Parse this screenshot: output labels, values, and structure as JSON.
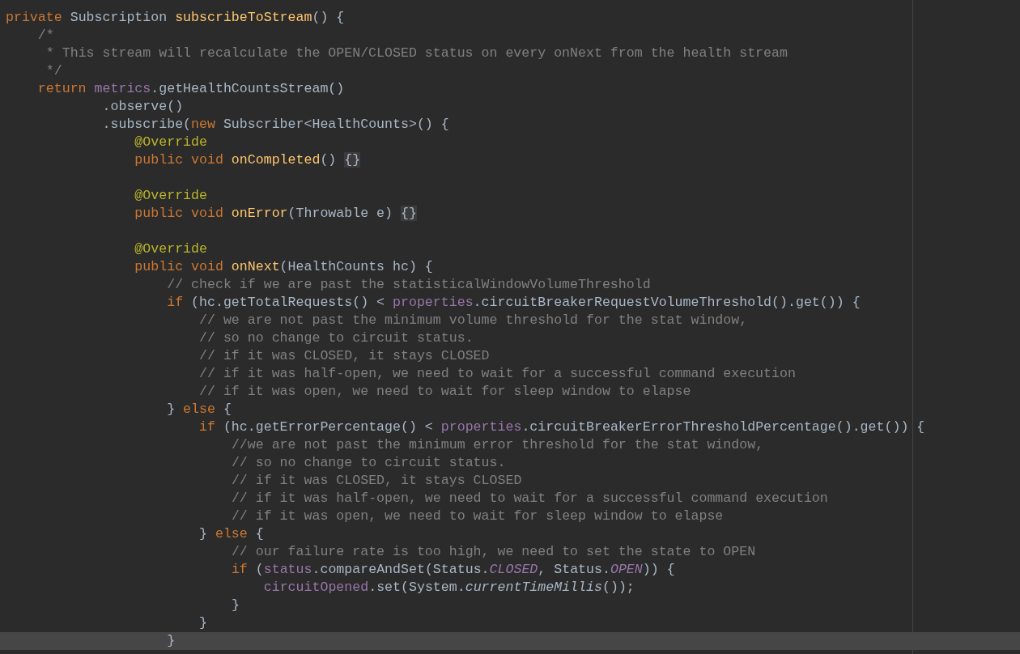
{
  "editor": {
    "lines": [
      {
        "current": false,
        "tokens": [
          {
            "kind": "keyword",
            "text": "private"
          },
          {
            "kind": "plain",
            "text": " Subscription "
          },
          {
            "kind": "decl",
            "text": "subscribeToStream"
          },
          {
            "kind": "plain",
            "text": "() {"
          }
        ]
      },
      {
        "current": false,
        "tokens": [
          {
            "kind": "comment",
            "text": "    /*"
          }
        ]
      },
      {
        "current": false,
        "tokens": [
          {
            "kind": "comment",
            "text": "     * This stream will recalculate the OPEN/CLOSED status on every onNext from the health stream"
          }
        ]
      },
      {
        "current": false,
        "tokens": [
          {
            "kind": "comment",
            "text": "     */"
          }
        ]
      },
      {
        "current": false,
        "tokens": [
          {
            "kind": "keyword",
            "text": "    return "
          },
          {
            "kind": "field",
            "text": "metrics"
          },
          {
            "kind": "plain",
            "text": ".getHealthCountsStream()"
          }
        ]
      },
      {
        "current": false,
        "tokens": [
          {
            "kind": "plain",
            "text": "            .observe()"
          }
        ]
      },
      {
        "current": false,
        "tokens": [
          {
            "kind": "plain",
            "text": "            .subscribe("
          },
          {
            "kind": "keyword",
            "text": "new "
          },
          {
            "kind": "plain",
            "text": "Subscriber<HealthCounts>() {"
          }
        ]
      },
      {
        "current": false,
        "tokens": [
          {
            "kind": "annotation",
            "text": "                @Override"
          }
        ]
      },
      {
        "current": false,
        "tokens": [
          {
            "kind": "keyword",
            "text": "                public void "
          },
          {
            "kind": "decl",
            "text": "onCompleted"
          },
          {
            "kind": "plain",
            "text": "() "
          },
          {
            "kind": "match",
            "text": "{}"
          }
        ]
      },
      {
        "current": false
      },
      {
        "current": false,
        "tokens": [
          {
            "kind": "annotation",
            "text": "                @Override"
          }
        ]
      },
      {
        "current": false,
        "tokens": [
          {
            "kind": "keyword",
            "text": "                public void "
          },
          {
            "kind": "decl",
            "text": "onError"
          },
          {
            "kind": "plain",
            "text": "(Throwable e) "
          },
          {
            "kind": "match",
            "text": "{}"
          }
        ]
      },
      {
        "current": false
      },
      {
        "current": false,
        "tokens": [
          {
            "kind": "annotation",
            "text": "                @Override"
          }
        ]
      },
      {
        "current": false,
        "tokens": [
          {
            "kind": "keyword",
            "text": "                public void "
          },
          {
            "kind": "decl",
            "text": "onNext"
          },
          {
            "kind": "plain",
            "text": "(HealthCounts hc) {"
          }
        ]
      },
      {
        "current": false,
        "tokens": [
          {
            "kind": "comment",
            "text": "                    // check if we are past the statisticalWindowVolumeThreshold"
          }
        ]
      },
      {
        "current": false,
        "tokens": [
          {
            "kind": "keyword",
            "text": "                    if "
          },
          {
            "kind": "plain",
            "text": "(hc.getTotalRequests() < "
          },
          {
            "kind": "field",
            "text": "properties"
          },
          {
            "kind": "plain",
            "text": ".circuitBreakerRequestVolumeThreshold().get()) {"
          }
        ]
      },
      {
        "current": false,
        "tokens": [
          {
            "kind": "comment",
            "text": "                        // we are not past the minimum volume threshold for the stat window,"
          }
        ]
      },
      {
        "current": false,
        "tokens": [
          {
            "kind": "comment",
            "text": "                        // so no change to circuit status."
          }
        ]
      },
      {
        "current": false,
        "tokens": [
          {
            "kind": "comment",
            "text": "                        // if it was CLOSED, it stays CLOSED"
          }
        ]
      },
      {
        "current": false,
        "tokens": [
          {
            "kind": "comment",
            "text": "                        // if it was half-open, we need to wait for a successful command execution"
          }
        ]
      },
      {
        "current": false,
        "tokens": [
          {
            "kind": "comment",
            "text": "                        // if it was open, we need to wait for sleep window to elapse"
          }
        ]
      },
      {
        "current": false,
        "tokens": [
          {
            "kind": "plain",
            "text": "                    } "
          },
          {
            "kind": "keyword",
            "text": "else"
          },
          {
            "kind": "plain",
            "text": " {"
          }
        ]
      },
      {
        "current": false,
        "tokens": [
          {
            "kind": "keyword",
            "text": "                        if "
          },
          {
            "kind": "plain",
            "text": "(hc.getErrorPercentage() < "
          },
          {
            "kind": "field",
            "text": "properties"
          },
          {
            "kind": "plain",
            "text": ".circuitBreakerErrorThresholdPercentage().get()) {"
          }
        ]
      },
      {
        "current": false,
        "tokens": [
          {
            "kind": "comment",
            "text": "                            //we are not past the minimum error threshold for the stat window,"
          }
        ]
      },
      {
        "current": false,
        "tokens": [
          {
            "kind": "comment",
            "text": "                            // so no change to circuit status."
          }
        ]
      },
      {
        "current": false,
        "tokens": [
          {
            "kind": "comment",
            "text": "                            // if it was CLOSED, it stays CLOSED"
          }
        ]
      },
      {
        "current": false,
        "tokens": [
          {
            "kind": "comment",
            "text": "                            // if it was half-open, we need to wait for a successful command execution"
          }
        ]
      },
      {
        "current": false,
        "tokens": [
          {
            "kind": "comment",
            "text": "                            // if it was open, we need to wait for sleep window to elapse"
          }
        ]
      },
      {
        "current": false,
        "tokens": [
          {
            "kind": "plain",
            "text": "                        } "
          },
          {
            "kind": "keyword",
            "text": "else"
          },
          {
            "kind": "plain",
            "text": " {"
          }
        ]
      },
      {
        "current": false,
        "tokens": [
          {
            "kind": "comment",
            "text": "                            // our failure rate is too high, we need to set the state to OPEN"
          }
        ]
      },
      {
        "current": false,
        "tokens": [
          {
            "kind": "keyword",
            "text": "                            if "
          },
          {
            "kind": "plain",
            "text": "("
          },
          {
            "kind": "field",
            "text": "status"
          },
          {
            "kind": "plain",
            "text": ".compareAndSet(Status."
          },
          {
            "kind": "constant",
            "text": "CLOSED"
          },
          {
            "kind": "plain",
            "text": ", Status."
          },
          {
            "kind": "constant",
            "text": "OPEN"
          },
          {
            "kind": "plain",
            "text": ")) {"
          }
        ]
      },
      {
        "current": false,
        "tokens": [
          {
            "kind": "field",
            "text": "                                circuitOpened"
          },
          {
            "kind": "plain",
            "text": ".set(System."
          },
          {
            "kind": "static",
            "text": "currentTimeMillis"
          },
          {
            "kind": "plain",
            "text": "());"
          }
        ]
      },
      {
        "current": false,
        "tokens": [
          {
            "kind": "plain",
            "text": "                            }"
          }
        ]
      },
      {
        "current": false,
        "tokens": [
          {
            "kind": "plain",
            "text": "                        }"
          }
        ]
      },
      {
        "current": true,
        "tokens": [
          {
            "kind": "plain",
            "text": "                    }"
          }
        ]
      }
    ]
  }
}
